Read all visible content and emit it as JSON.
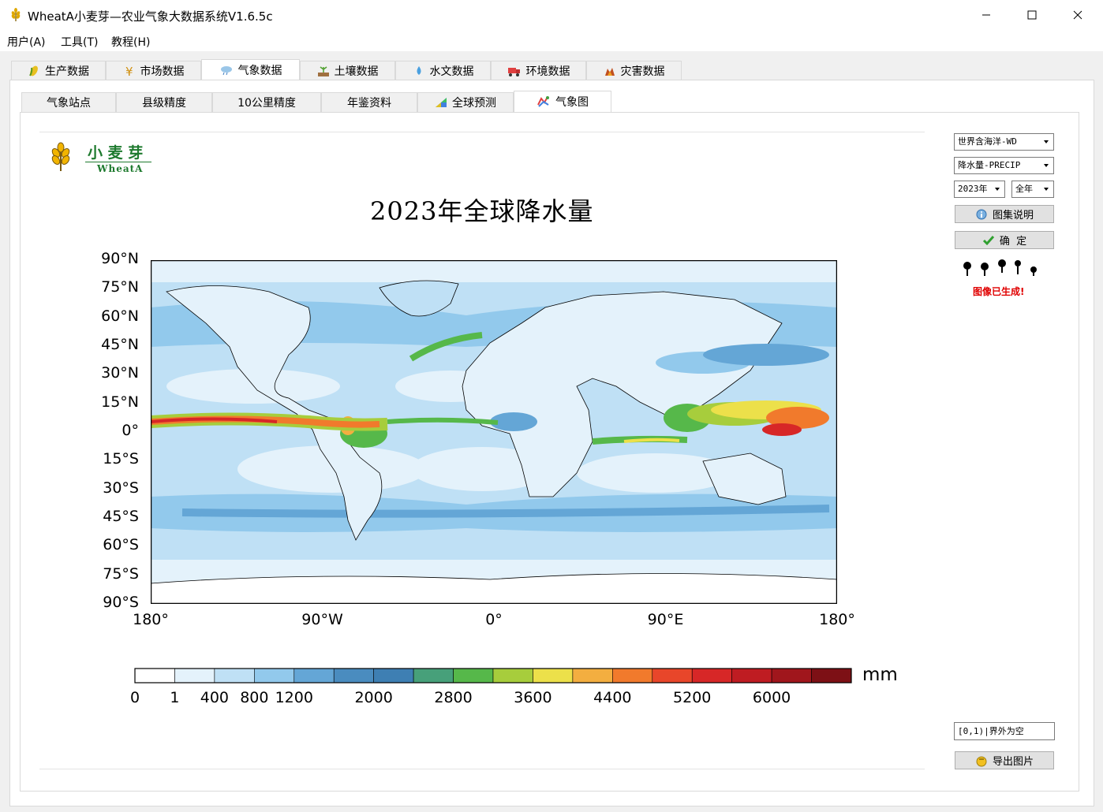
{
  "window": {
    "title": "WheatA小麦芽—农业气象大数据系统V1.6.5c"
  },
  "menu": [
    {
      "label": "用户(A)"
    },
    {
      "label": "工具(T)"
    },
    {
      "label": "教程(H)"
    }
  ],
  "outer_tabs": [
    {
      "label": "生产数据",
      "icon": "corn-icon",
      "active": false
    },
    {
      "label": "市场数据",
      "icon": "yen-icon",
      "active": false
    },
    {
      "label": "气象数据",
      "icon": "cloud-rain-icon",
      "active": true
    },
    {
      "label": "土壤数据",
      "icon": "soil-icon",
      "active": false
    },
    {
      "label": "水文数据",
      "icon": "water-icon",
      "active": false
    },
    {
      "label": "环境数据",
      "icon": "truck-icon",
      "active": false
    },
    {
      "label": "灾害数据",
      "icon": "disaster-icon",
      "active": false
    }
  ],
  "inner_tabs": [
    {
      "label": "气象站点",
      "icon": "",
      "active": false
    },
    {
      "label": "县级精度",
      "icon": "",
      "active": false
    },
    {
      "label": "10公里精度",
      "icon": "",
      "active": false
    },
    {
      "label": "年鉴资料",
      "icon": "",
      "active": false
    },
    {
      "label": "全球预测",
      "icon": "chart-icon",
      "active": false
    },
    {
      "label": "气象图",
      "icon": "map-icon",
      "active": true
    }
  ],
  "figure": {
    "title": "2023年全球降水量",
    "logo": {
      "text_cn": "小 麦 芽",
      "text_en": "WheatA"
    },
    "lat_ticks": [
      "90°N",
      "75°N",
      "60°N",
      "45°N",
      "30°N",
      "15°N",
      "0°",
      "15°S",
      "30°S",
      "45°S",
      "60°S",
      "75°S",
      "90°S"
    ],
    "lon_ticks": [
      "180°",
      "90°W",
      "0°",
      "90°E",
      "180°"
    ],
    "colorbar": {
      "unit": "mm",
      "colors": [
        "#ffffff",
        "#e4f2fb",
        "#bfe0f5",
        "#92c9ec",
        "#64a6d6",
        "#4a8cbf",
        "#3e7fb3",
        "#47a07a",
        "#56b84a",
        "#a7cd3c",
        "#ece04a",
        "#f3ae40",
        "#f17a2c",
        "#e8462a",
        "#d72727",
        "#bf1c22",
        "#a0161c",
        "#7d1015"
      ],
      "tick_labels": [
        "0",
        "1",
        "400",
        "800",
        "1200",
        "2000",
        "2800",
        "3600",
        "4400",
        "5200",
        "6000"
      ]
    }
  },
  "controls": {
    "region": "世界含海洋-WD",
    "variable": "降水量-PRECIP",
    "year": "2023年",
    "period": "全年",
    "legend_button": "图集说明",
    "confirm_button": "确  定",
    "status": "图像已生成!",
    "readout": "[0,1)|界外为空",
    "export_button": "导出图片"
  }
}
